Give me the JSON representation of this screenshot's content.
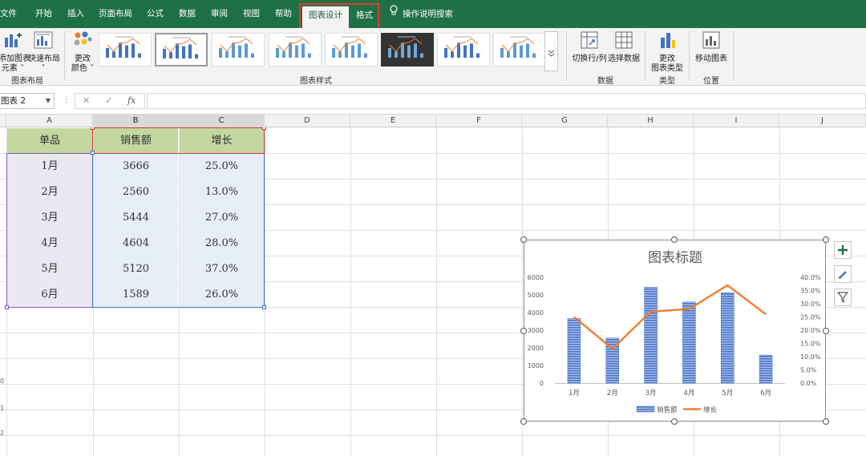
{
  "ribbon_tabs": [
    {
      "label": "文件"
    },
    {
      "label": "开始"
    },
    {
      "label": "插入"
    },
    {
      "label": "页面布局"
    },
    {
      "label": "公式"
    },
    {
      "label": "数据"
    },
    {
      "label": "审阅"
    },
    {
      "label": "视图"
    },
    {
      "label": "帮助"
    },
    {
      "label": "图表设计"
    },
    {
      "label": "格式"
    }
  ],
  "tell_me": "操作说明搜索",
  "ribbon": {
    "add_element": "添加图表\n元素 ˅",
    "quick_layout": "快速布局\n˅",
    "change_colors": "更改\n颜色 ˅",
    "switch_row_col": "切换行/列",
    "select_data": "选择数据",
    "change_type": "更改\n图表类型",
    "move_chart": "移动图表",
    "groups": {
      "layout": "图表布局",
      "styles": "图表样式",
      "data": "数据",
      "type": "类型",
      "location": "位置"
    }
  },
  "formula_bar": {
    "name_box": "图表 2",
    "cancel": "✕",
    "enter": "✓",
    "fx": "fx",
    "value": ""
  },
  "columns": [
    "A",
    "B",
    "C",
    "D",
    "E",
    "F",
    "G",
    "H",
    "I",
    "J"
  ],
  "row_labels_visible": [
    "0",
    "1",
    "2"
  ],
  "table": {
    "headers": [
      "单品",
      "销售额",
      "增长"
    ],
    "rows": [
      [
        "1月",
        "3666",
        "25.0%"
      ],
      [
        "2月",
        "2560",
        "13.0%"
      ],
      [
        "3月",
        "5444",
        "27.0%"
      ],
      [
        "4月",
        "4604",
        "28.0%"
      ],
      [
        "5月",
        "5120",
        "37.0%"
      ],
      [
        "6月",
        "1589",
        "26.0%"
      ]
    ]
  },
  "colors": {
    "ribbon_green": "#1f7145",
    "bar_blue": "#4472c4",
    "line_orange": "#ed7d31",
    "context_highlight": "#e53935"
  },
  "chart_side_buttons": [
    "plus-icon",
    "brush-icon",
    "filter-icon"
  ],
  "chart_data": {
    "type": "bar",
    "title": "图表标题",
    "categories": [
      "1月",
      "2月",
      "3月",
      "4月",
      "5月",
      "6月"
    ],
    "series": [
      {
        "name": "销售额",
        "type": "bar",
        "axis": "left",
        "values": [
          3666,
          2560,
          5444,
          4604,
          5120,
          1589
        ]
      },
      {
        "name": "增长",
        "type": "line",
        "axis": "right",
        "values": [
          25.0,
          13.0,
          27.0,
          28.0,
          37.0,
          26.0
        ]
      }
    ],
    "y_left": {
      "min": 0,
      "max": 6000,
      "ticks": [
        "0",
        "1000",
        "2000",
        "3000",
        "4000",
        "5000",
        "6000"
      ]
    },
    "y_right": {
      "min": 0,
      "max": 40,
      "ticks": [
        "0.0%",
        "5.0%",
        "10.0%",
        "15.0%",
        "20.0%",
        "25.0%",
        "30.0%",
        "35.0%",
        "40.0%"
      ]
    },
    "legend": "bottom",
    "grid": false
  }
}
